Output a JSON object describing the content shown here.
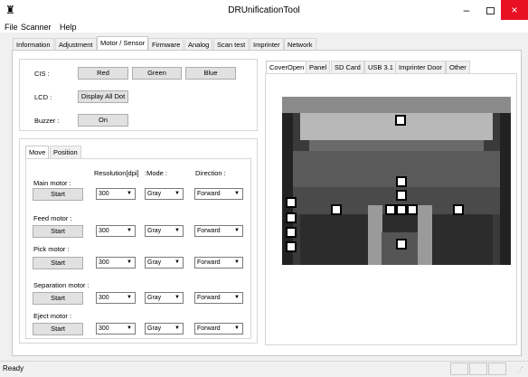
{
  "window": {
    "title": "DRUnificationTool",
    "minimize": "–",
    "close": "×"
  },
  "menu": [
    "File",
    "Scanner",
    "Help"
  ],
  "tabs": [
    "Information",
    "Adjustment",
    "Motor / Sensor",
    "Firmware",
    "Analog",
    "Scan test",
    "Imprinter",
    "Network"
  ],
  "active_tab": "Motor / Sensor",
  "sensor_panel": {
    "cis_label": "CIS :",
    "cis_buttons": [
      "Red",
      "Green",
      "Blue"
    ],
    "lcd_label": "LCD :",
    "lcd_button": "Display All Dot",
    "buzzer_label": "Buzzer :",
    "buzzer_button": "On"
  },
  "motor_tabs": [
    "Move",
    "Position"
  ],
  "motor_headers": {
    "resolution": "Resolution[dpi]",
    "mode": ":Mode :",
    "direction": "Direction :"
  },
  "motors": [
    {
      "label": "Main motor :",
      "button": "Start",
      "resolution": "300",
      "mode": "Gray",
      "direction": "Forward"
    },
    {
      "label": "Feed motor :",
      "button": "Start",
      "resolution": "300",
      "mode": "Gray",
      "direction": "Forward"
    },
    {
      "label": "Pick motor :",
      "button": "Start",
      "resolution": "300",
      "mode": "Gray",
      "direction": "Forward"
    },
    {
      "label": "Separation motor :",
      "button": "Start",
      "resolution": "300",
      "mode": "Gray",
      "direction": "Forward"
    },
    {
      "label": "Eject motor :",
      "button": "Start",
      "resolution": "300",
      "mode": "Gray",
      "direction": "Forward"
    }
  ],
  "sensor_tabs": [
    "CoverOpen",
    "Panel",
    "SD Card",
    "USB 3.1",
    "Imprinter Door",
    "Other"
  ],
  "status": {
    "text": "Ready"
  },
  "colors": {
    "close_red": "#e81123",
    "photo_bg": "#2a2a2a"
  }
}
